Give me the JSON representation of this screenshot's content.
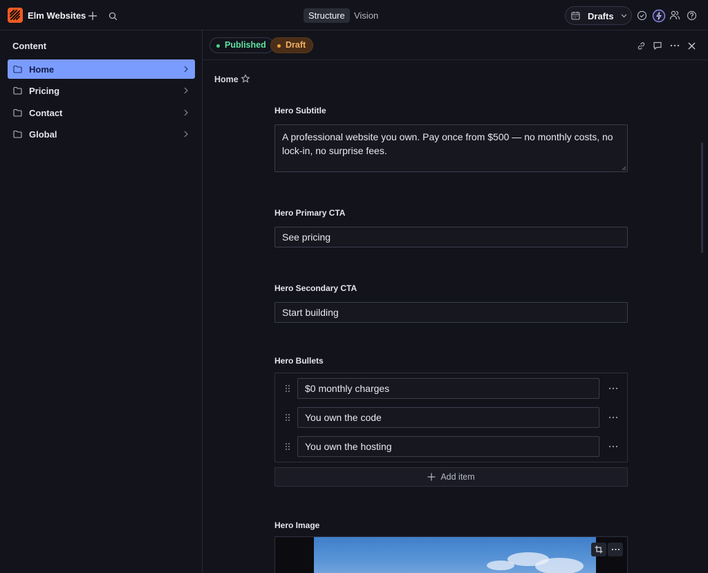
{
  "app": {
    "title": "Elm Websites"
  },
  "topbar": {
    "tabs": [
      {
        "label": "Structure",
        "active": true
      },
      {
        "label": "Vision",
        "active": false
      }
    ],
    "perspective": {
      "label": "Drafts"
    }
  },
  "sidebar": {
    "title": "Content",
    "items": [
      {
        "label": "Home",
        "active": true
      },
      {
        "label": "Pricing",
        "active": false
      },
      {
        "label": "Contact",
        "active": false
      },
      {
        "label": "Global",
        "active": false
      }
    ]
  },
  "document": {
    "status": {
      "published": "Published",
      "draft": "Draft"
    },
    "breadcrumb": "Home",
    "fields": {
      "hero_subtitle": {
        "label": "Hero Subtitle",
        "value": "A professional website you own. Pay once from $500 — no monthly costs, no lock-in, no surprise fees."
      },
      "hero_primary_cta": {
        "label": "Hero Primary CTA",
        "value": "See pricing"
      },
      "hero_secondary_cta": {
        "label": "Hero Secondary CTA",
        "value": "Start building"
      },
      "hero_bullets": {
        "label": "Hero Bullets",
        "items": [
          "$0 monthly charges",
          "You own the code",
          "You own the hosting"
        ],
        "add_label": "Add item"
      },
      "hero_image": {
        "label": "Hero Image"
      }
    }
  },
  "colors": {
    "accent": "#7b9cff",
    "brand": "#f05a22",
    "published": "#43d48b",
    "draft": "#f2a040",
    "background": "#13141b"
  }
}
